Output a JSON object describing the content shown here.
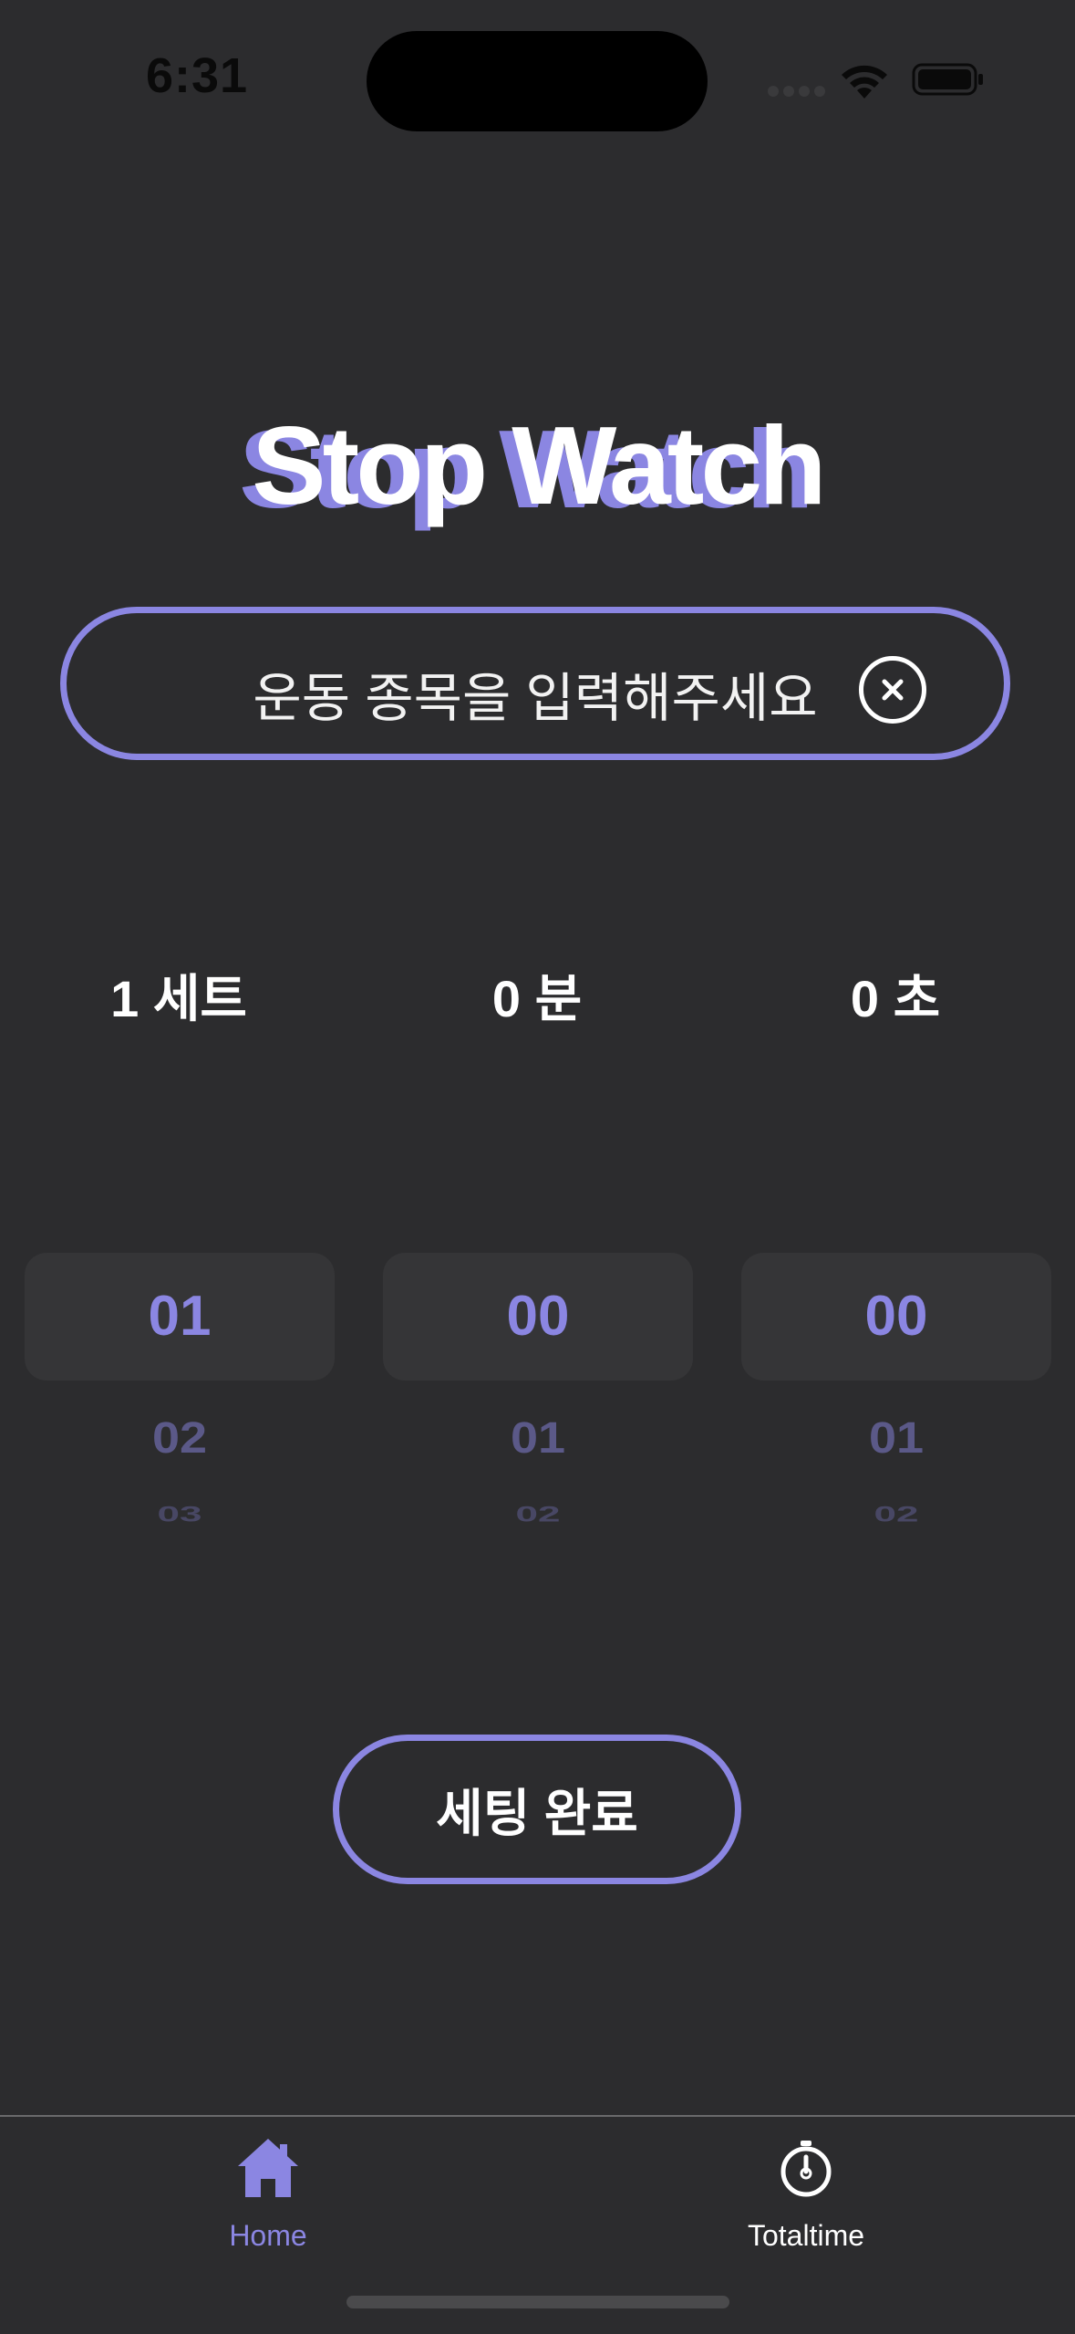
{
  "status_bar": {
    "time": "6:31"
  },
  "title": "Stop Watch",
  "exercise_input": {
    "placeholder": "운동 종목을 입력해주세요",
    "clear_icon": "close-circle-icon"
  },
  "labels": {
    "sets": "1 세트",
    "minutes": "0 분",
    "seconds": "0 초"
  },
  "pickers": {
    "sets": [
      "01",
      "02",
      "03"
    ],
    "minutes": [
      "00",
      "01",
      "02"
    ],
    "seconds": [
      "00",
      "01",
      "02"
    ]
  },
  "done_button": "세팅 완료",
  "tabs": [
    {
      "label": "Home",
      "icon": "house-icon",
      "selected": true
    },
    {
      "label": "Totaltime",
      "icon": "stopwatch-icon",
      "selected": false
    }
  ],
  "colors": {
    "accent": "#8b86e2",
    "background": "#2c2c2e",
    "picker_highlight": "#353537"
  }
}
